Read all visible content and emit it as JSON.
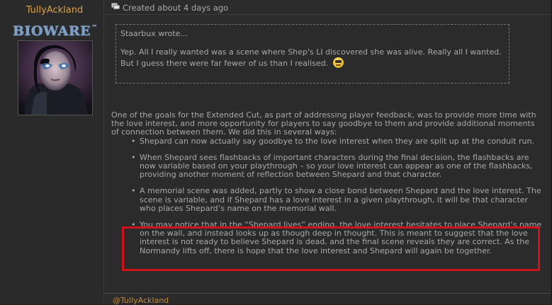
{
  "user": {
    "name": "TullyAckland",
    "logo_text": "BIOWARE",
    "logo_tm": "™",
    "logo_color": "#7ea0c6",
    "name_color": "#d9a14a"
  },
  "post": {
    "meta_icon": "comment-icon",
    "created": "Created about 4 days ago",
    "quote": {
      "author": "Staarbux wrote...",
      "text": "Yep. All I really wanted was a scene where Shep's LI discovered she was alive. Really all I wanted. But I guess there were far fewer of us than I realised.",
      "emoticon": "smiley-icon"
    },
    "intro": "One of the goals for the Extended Cut, as part of addressing player feedback, was to provide more time with the love interest, and more opportunity for players to say goodbye to them and provide additional moments of connection between them. We did this in several ways:",
    "bullets": [
      "Shepard can now actually say goodbye to the love interest when they are split up at the conduit run.",
      "When Shepard sees flashbacks of important characters during the final decision, the flashbacks are now variable based on your playthrough – so your love interest can appear as one of the flashbacks, providing another moment of reflection between Shepard and that character.",
      "A memorial scene was added, partly to show a close bond between Shepard and the love interest. The scene is variable, and if Shepard has a love interest in a given playthrough, it will be that character who places Shepard’s name on the memorial wall.",
      "You may notice that in the “Shepard lives” ending, the love interest hesitates to place Shepard’s name on the wall, and instead looks up as though deep in thought. This is meant to suggest that the love interest is not ready to believe Shepard is dead, and the final scene reveals they are correct. As the Normandy lifts off, there is hope that the love interest and Shepard will again be together."
    ],
    "highlight_color": "#d0121b",
    "signature": "@TullyAckland"
  }
}
